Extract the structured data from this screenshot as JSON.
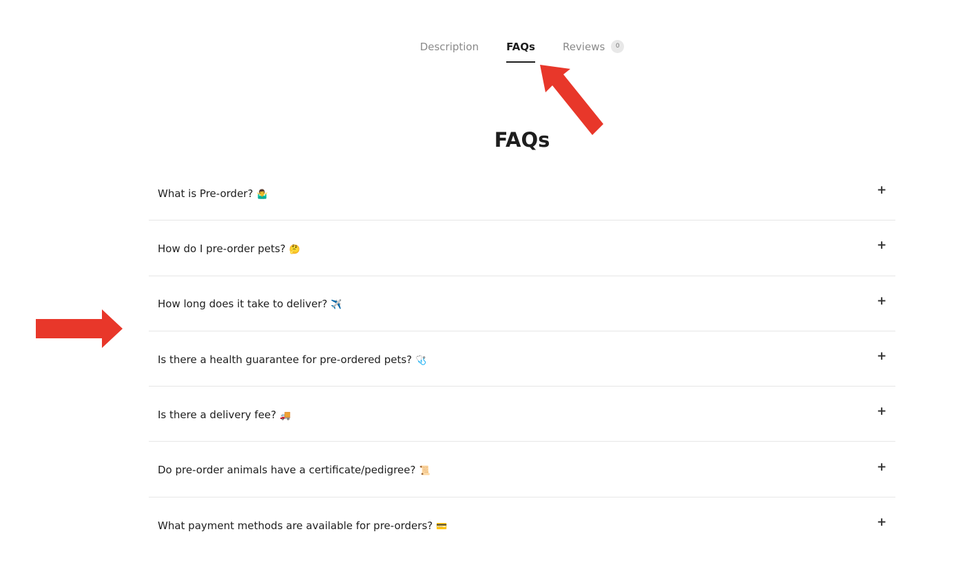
{
  "tabs": [
    {
      "label": "Description",
      "active": false
    },
    {
      "label": "FAQs",
      "active": true
    },
    {
      "label": "Reviews",
      "active": false,
      "count": "0"
    }
  ],
  "heading": "FAQs",
  "faqs": [
    {
      "question": "What is Pre-order?",
      "emoji": "🤷‍♂️",
      "toggle": "+"
    },
    {
      "question": "How do I pre-order pets?",
      "emoji": "🤔",
      "toggle": "+"
    },
    {
      "question": "How long does it take to deliver?",
      "emoji": "✈️",
      "toggle": "+"
    },
    {
      "question": "Is there a health guarantee for pre-ordered pets?",
      "emoji": "🩺",
      "toggle": "+"
    },
    {
      "question": "Is there a delivery fee?",
      "emoji": "🚚",
      "toggle": "+"
    },
    {
      "question": "Do pre-order animals have a certificate/pedigree?",
      "emoji": "📜",
      "toggle": "+"
    },
    {
      "question": "What payment methods are available for pre-orders?",
      "emoji": "💳",
      "toggle": "+"
    }
  ],
  "colors": {
    "annotation_arrow": "#e8372a",
    "text": "#1e1e1e",
    "muted": "#8a8a8a",
    "divider": "#e6e6e6"
  }
}
